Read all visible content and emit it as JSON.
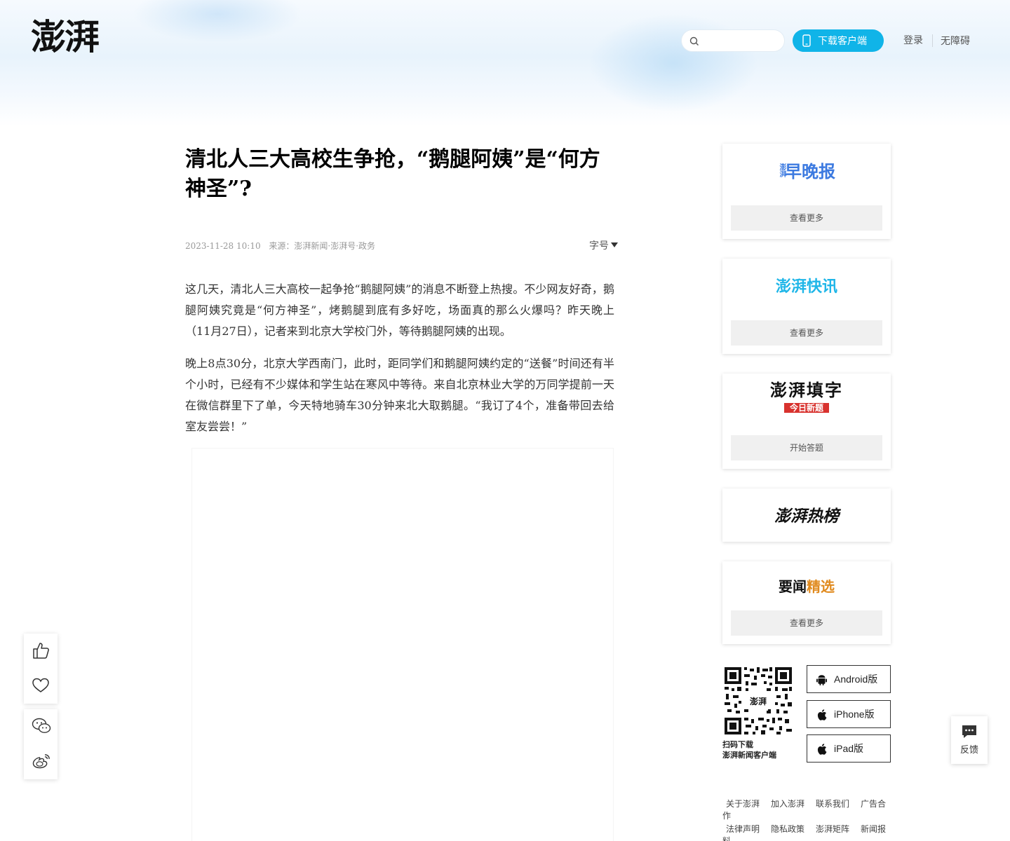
{
  "header": {
    "logo_text": "澎湃",
    "search_placeholder": "",
    "download_label": "下载客户端",
    "login_label": "登录",
    "accessibility_label": "无障碍"
  },
  "article": {
    "title": "清北人三大高校生争抢，“鹅腿阿姨”是“何方神圣”?",
    "date": "2023-11-28 10:10",
    "source": "来源：澎湃新闻·澎湃号·政务",
    "font_size_label": "字号",
    "paragraphs": [
      "这几天，清北人三大高校一起争抢“鹅腿阿姨”的消息不断登上热搜。不少网友好奇，鹅腿阿姨究竟是“何方神圣”，烤鹅腿到底有多好吃，场面真的那么火爆吗？昨天晚上（11月27日），记者来到北京大学校门外，等待鹅腿阿姨的出现。",
      "晚上8点30分，北京大学西南门，此时，距同学们和鹅腿阿姨约定的“送餐”时间还有半个小时，已经有不少媒体和学生站在寒风中等待。来自北京林业大学的万同学提前一天在微信群里下了单，今天特地骑车30分钟来北大取鹅腿。“我订了4个，准备带回去给室友尝尝！”"
    ]
  },
  "sidebar": {
    "cards": [
      {
        "logo": "早晚报",
        "logo_prefix": "澎湃",
        "button": "查看更多"
      },
      {
        "logo": "澎湃快讯",
        "button": "查看更多"
      },
      {
        "logo": "澎湃填字",
        "sub": "今日新题",
        "button": "开始答题"
      },
      {
        "logo": "澎湃热榜"
      },
      {
        "logo_a": "要闻",
        "logo_b": "精选",
        "button": "查看更多"
      }
    ],
    "qr_caption_1": "扫码下载",
    "qr_caption_2": "澎湃新闻客户端",
    "apps": [
      "Android版",
      "iPhone版",
      "iPad版"
    ],
    "footer_row1": [
      "关于澎湃",
      "加入澎湃",
      "联系我们",
      "广告合作"
    ],
    "footer_row2": [
      "法律声明",
      "隐私政策",
      "澎湃矩阵",
      "新闻报料"
    ]
  },
  "feedback_label": "反馈",
  "colors": {
    "accent": "#10b4e8",
    "brand_blue": "#3c7ae0",
    "cyan": "#1fb6e8",
    "red": "#d8322e",
    "orange": "#e08a1e"
  }
}
